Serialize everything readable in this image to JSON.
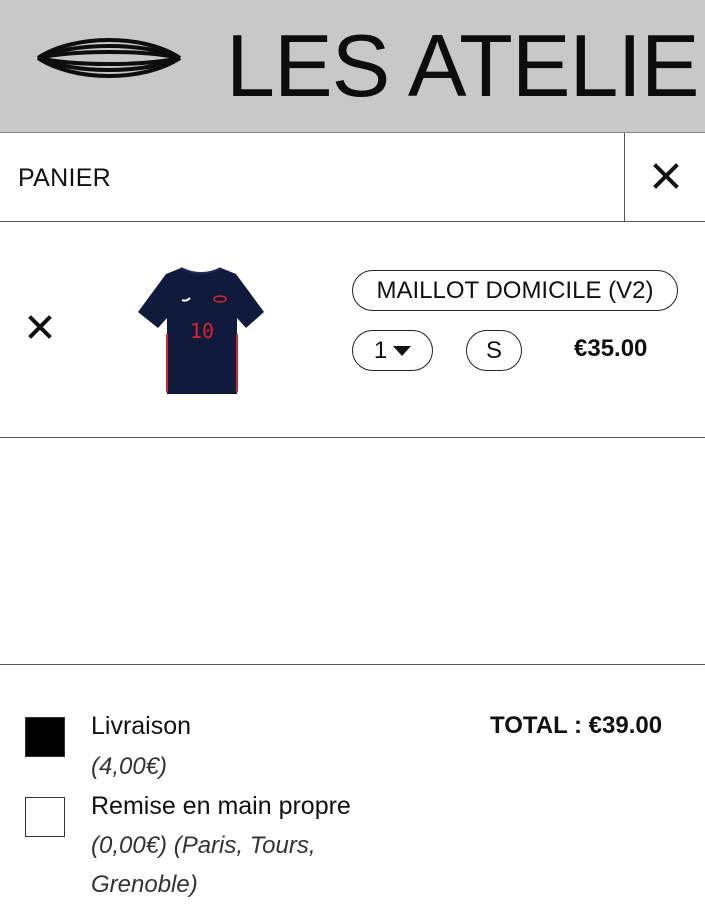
{
  "header": {
    "brand": "LES ATELIER"
  },
  "cart": {
    "title": "PANIER"
  },
  "item": {
    "name": "MAILLOT DOMICILE (V2)",
    "quantity": "1",
    "size": "S",
    "price": "€35.00",
    "shirt_number": "10"
  },
  "shipping": {
    "options": [
      {
        "label": "Livraison",
        "detail": "(4,00€)",
        "selected": true
      },
      {
        "label": "Remise en main propre",
        "detail": "(0,00€) (Paris, Tours, Grenoble)",
        "selected": false
      }
    ],
    "total": "TOTAL : €39.00"
  },
  "colors": {
    "header_bg": "#c8c8c8",
    "shirt_navy": "#0f1a3d",
    "shirt_accent": "#d8242a"
  }
}
